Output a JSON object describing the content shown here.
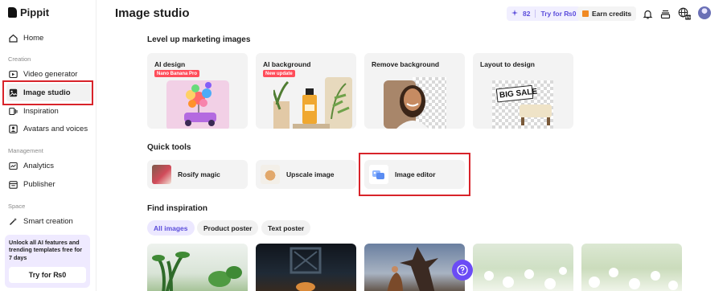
{
  "brand": {
    "name": "Pippit"
  },
  "sidebar": {
    "home": "Home",
    "creation_label": "Creation",
    "video_generator": "Video generator",
    "image_studio": "Image studio",
    "inspiration": "Inspiration",
    "avatars_voices": "Avatars and voices",
    "management_label": "Management",
    "analytics": "Analytics",
    "publisher": "Publisher",
    "space_label": "Space",
    "smart_creation": "Smart creation",
    "upgrade_text": "Unlock all AI features and trending templates free for 7 days",
    "upgrade_button": "Try for ₨0"
  },
  "header": {
    "title": "Image studio",
    "credits": "82",
    "credits_icon": "sparkle-icon",
    "try_label": "Try for ₨0",
    "earn_label": "Earn credits",
    "icons": [
      "bell-icon",
      "inbox-icon",
      "globe-language-icon",
      "avatar"
    ]
  },
  "level_up": {
    "title": "Level up marketing images",
    "cards": [
      {
        "title": "AI design",
        "badge": "Nano Banana Pro"
      },
      {
        "title": "AI background",
        "badge": "New update"
      },
      {
        "title": "Remove background",
        "badge": ""
      },
      {
        "title": "Layout to design",
        "badge": "",
        "sign_text": "BIG SALE"
      }
    ]
  },
  "quick_tools": {
    "title": "Quick tools",
    "items": [
      "Rosify magic",
      "Upscale image",
      "Image editor"
    ]
  },
  "inspiration": {
    "title": "Find inspiration",
    "tabs": [
      "All images",
      "Product poster",
      "Text poster"
    ],
    "active_tab": "All images"
  },
  "colors": {
    "accent": "#5b4ddb",
    "highlight": "#d8232a",
    "help": "#6b4cf5"
  }
}
